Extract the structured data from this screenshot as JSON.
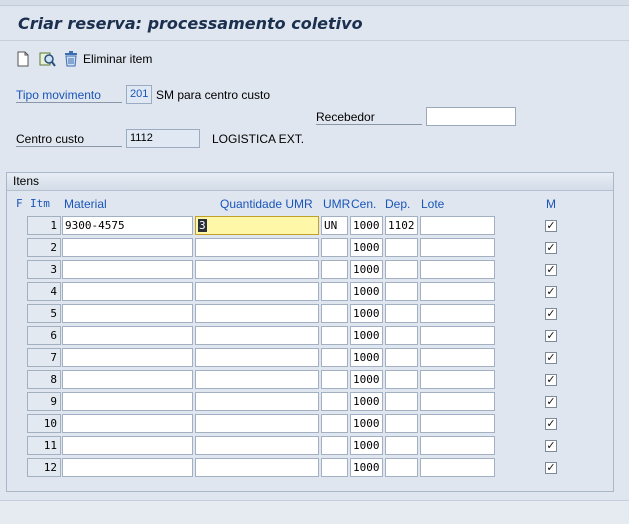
{
  "title": "Criar reserva: processamento coletivo",
  "toolbar": {
    "new_icon": "new-document-icon",
    "find_icon": "find-icon",
    "delete_icon": "trash-icon",
    "delete_label": "Eliminar item"
  },
  "header": {
    "movement_type_label": "Tipo movimento",
    "movement_type_value": "201",
    "movement_type_text": "SM para centro custo",
    "recipient_label": "Recebedor",
    "recipient_value": "",
    "cost_center_label": "Centro custo",
    "cost_center_value": "1112",
    "cost_center_text": "LOGISTICA EXT."
  },
  "items_group": {
    "title": "Itens",
    "columns": {
      "f": "F",
      "itm": "Itm",
      "material": "Material",
      "qty": "Quantidade UMR",
      "umr": "UMR",
      "cen": "Cen.",
      "dep": "Dep.",
      "lote": "Lote",
      "m": "M"
    },
    "rows": [
      {
        "itm": "1",
        "material": "9300-4575",
        "qty": "3",
        "umr": "UN",
        "cen": "1000",
        "dep": "1102",
        "lote": "",
        "m": true
      },
      {
        "itm": "2",
        "material": "",
        "qty": "",
        "umr": "",
        "cen": "1000",
        "dep": "",
        "lote": "",
        "m": true
      },
      {
        "itm": "3",
        "material": "",
        "qty": "",
        "umr": "",
        "cen": "1000",
        "dep": "",
        "lote": "",
        "m": true
      },
      {
        "itm": "4",
        "material": "",
        "qty": "",
        "umr": "",
        "cen": "1000",
        "dep": "",
        "lote": "",
        "m": true
      },
      {
        "itm": "5",
        "material": "",
        "qty": "",
        "umr": "",
        "cen": "1000",
        "dep": "",
        "lote": "",
        "m": true
      },
      {
        "itm": "6",
        "material": "",
        "qty": "",
        "umr": "",
        "cen": "1000",
        "dep": "",
        "lote": "",
        "m": true
      },
      {
        "itm": "7",
        "material": "",
        "qty": "",
        "umr": "",
        "cen": "1000",
        "dep": "",
        "lote": "",
        "m": true
      },
      {
        "itm": "8",
        "material": "",
        "qty": "",
        "umr": "",
        "cen": "1000",
        "dep": "",
        "lote": "",
        "m": true
      },
      {
        "itm": "9",
        "material": "",
        "qty": "",
        "umr": "",
        "cen": "1000",
        "dep": "",
        "lote": "",
        "m": true
      },
      {
        "itm": "10",
        "material": "",
        "qty": "",
        "umr": "",
        "cen": "1000",
        "dep": "",
        "lote": "",
        "m": true
      },
      {
        "itm": "11",
        "material": "",
        "qty": "",
        "umr": "",
        "cen": "1000",
        "dep": "",
        "lote": "",
        "m": true
      },
      {
        "itm": "12",
        "material": "",
        "qty": "",
        "umr": "",
        "cen": "1000",
        "dep": "",
        "lote": "",
        "m": true
      }
    ]
  }
}
